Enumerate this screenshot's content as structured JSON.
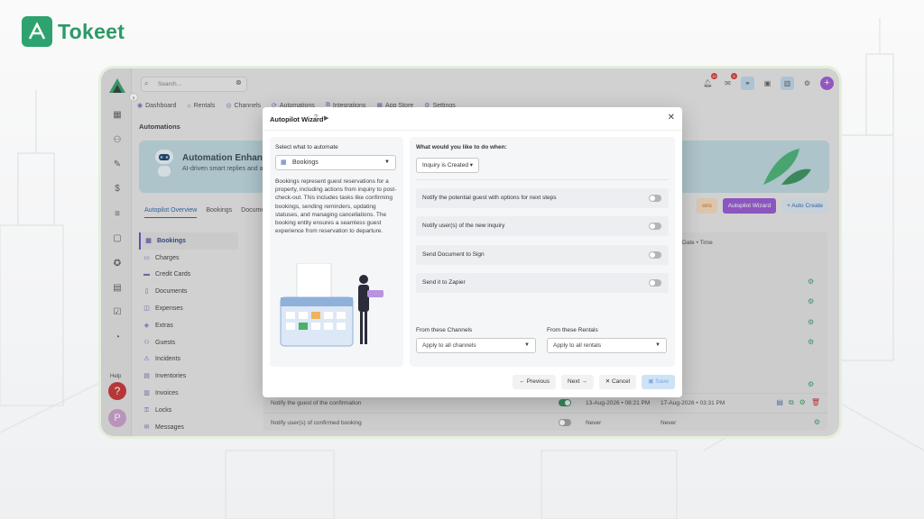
{
  "brand": {
    "name": "Tokeet"
  },
  "topbar": {
    "search_placeholder": "Search...",
    "notif_count": "10",
    "msg_count": "8"
  },
  "nav": {
    "tabs": [
      "Dashboard",
      "Rentals",
      "Channels",
      "Automations",
      "Integrations",
      "App Store",
      "Settings"
    ]
  },
  "page": {
    "title": "Automations",
    "banner_title": "Automation Enhances",
    "banner_text": "AI-driven smart replies and a",
    "subtabs": [
      "Autopilot Overview",
      "Bookings",
      "Documents"
    ],
    "buttons": {
      "actions": "ons",
      "autopilot_wizard": "Autopilot Wizard",
      "auto_create": "+ Auto Create"
    },
    "categories": [
      "Bookings",
      "Charges",
      "Credit Cards",
      "Documents",
      "Expenses",
      "Extras",
      "Guests",
      "Incidents",
      "Inventories",
      "Invoices",
      "Locks",
      "Messages"
    ],
    "help_label": "Help",
    "help_icon": "?",
    "avatar_initial": "P"
  },
  "table": {
    "col_triggered": "ggered Date • Time",
    "rows": [
      {
        "name": "Notify the guest of the confirmation",
        "last": "13-Aug-2026 • 08:21 PM",
        "next": "17-Aug-2026 • 03:31 PM",
        "enabled": true
      },
      {
        "name": "Notify user(s) of confirmed booking",
        "last": "Never",
        "next": "Never",
        "enabled": false
      }
    ]
  },
  "modal": {
    "title": "Autopilot Wizard",
    "select_label": "Select what to automate",
    "selected_entity": "Bookings",
    "description": "Bookings represent guest reservations for a property, including actions from inquiry to post-check-out. This includes tasks like confirming bookings, sending reminders, updating statuses, and managing cancellations. The booking entity ensures a seamless guest experience from reservation to departure.",
    "question": "What would you like to do when:",
    "trigger": "Inquiry is Created",
    "actions": [
      "Notify the potential guest with options for next steps",
      "Notify user(s) of the new inquiry",
      "Send Document to Sign",
      "Send it to Zapier"
    ],
    "channels_label": "From these Channels",
    "channels_value": "Apply to all channels",
    "rentals_label": "From these Rentals",
    "rentals_value": "Apply to all rentals",
    "buttons": {
      "previous": "← Previous",
      "next": "Next →",
      "cancel": "✕ Cancel",
      "save": "Save"
    }
  },
  "colors": {
    "accent": "#8f4fcf",
    "brand": "#2ea36f",
    "toggle_on": "#2a8a55"
  }
}
